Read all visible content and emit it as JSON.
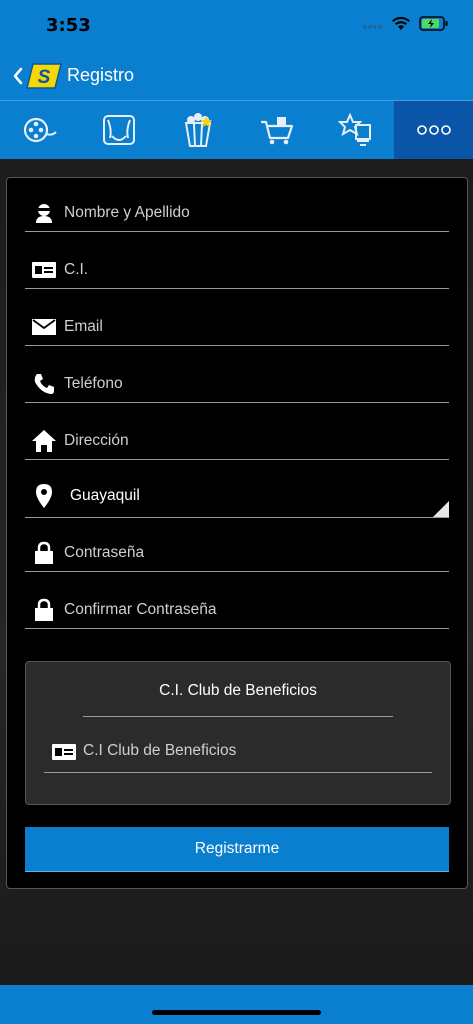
{
  "status": {
    "time": "3:53"
  },
  "nav": {
    "title": "Registro",
    "logo_letter": "S"
  },
  "tabs": [
    {
      "icon": "film-reel-icon"
    },
    {
      "icon": "theater-screen-icon"
    },
    {
      "icon": "popcorn-icon"
    },
    {
      "icon": "shopping-cart-icon"
    },
    {
      "icon": "star-promo-icon"
    },
    {
      "icon": "more-dots-icon",
      "label": "ooo",
      "active": true
    }
  ],
  "form": {
    "name_placeholder": "Nombre y Apellido",
    "ci_placeholder": "C.I.",
    "email_placeholder": "Email",
    "phone_placeholder": "Teléfono",
    "address_placeholder": "Dirección",
    "city_value": "Guayaquil",
    "password_placeholder": "Contraseña",
    "confirm_placeholder": "Confirmar Contraseña"
  },
  "club": {
    "title": "C.I. Club de Beneficios",
    "field_placeholder": "C.I Club de Beneficios"
  },
  "register_button": "Registrarme",
  "colors": {
    "brand_blue": "#0a7fd0",
    "active_tab": "#0a55a8",
    "logo_yellow": "#f5d800"
  }
}
